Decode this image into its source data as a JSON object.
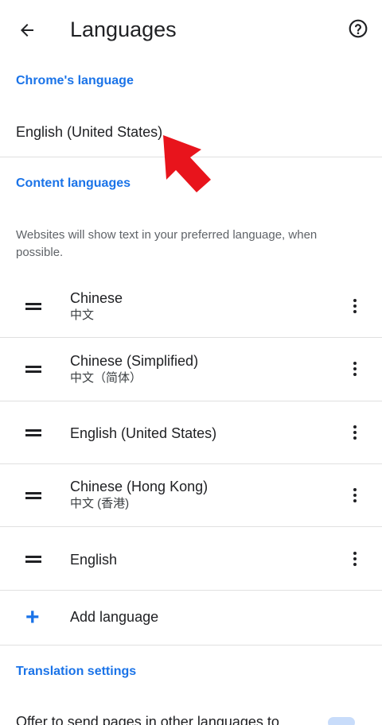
{
  "toolbar": {
    "title": "Languages",
    "back_icon": "arrow-back-icon",
    "help_icon": "help-icon"
  },
  "chrome_language": {
    "header": "Chrome's language",
    "value": "English (United States)"
  },
  "content_languages": {
    "header": "Content languages",
    "description": "Websites will show text in your preferred language, when possible.",
    "items": [
      {
        "name": "Chinese",
        "native": "中文"
      },
      {
        "name": "Chinese (Simplified)",
        "native": "中文（简体）"
      },
      {
        "name": "English (United States)",
        "native": ""
      },
      {
        "name": "Chinese (Hong Kong)",
        "native": "中文 (香港)"
      },
      {
        "name": "English",
        "native": ""
      }
    ],
    "add_label": "Add language"
  },
  "translation": {
    "header": "Translation settings",
    "offer_text": "Offer to send pages in other languages to"
  },
  "colors": {
    "accent": "#1a73e8",
    "annotation_arrow": "#e8141c"
  }
}
